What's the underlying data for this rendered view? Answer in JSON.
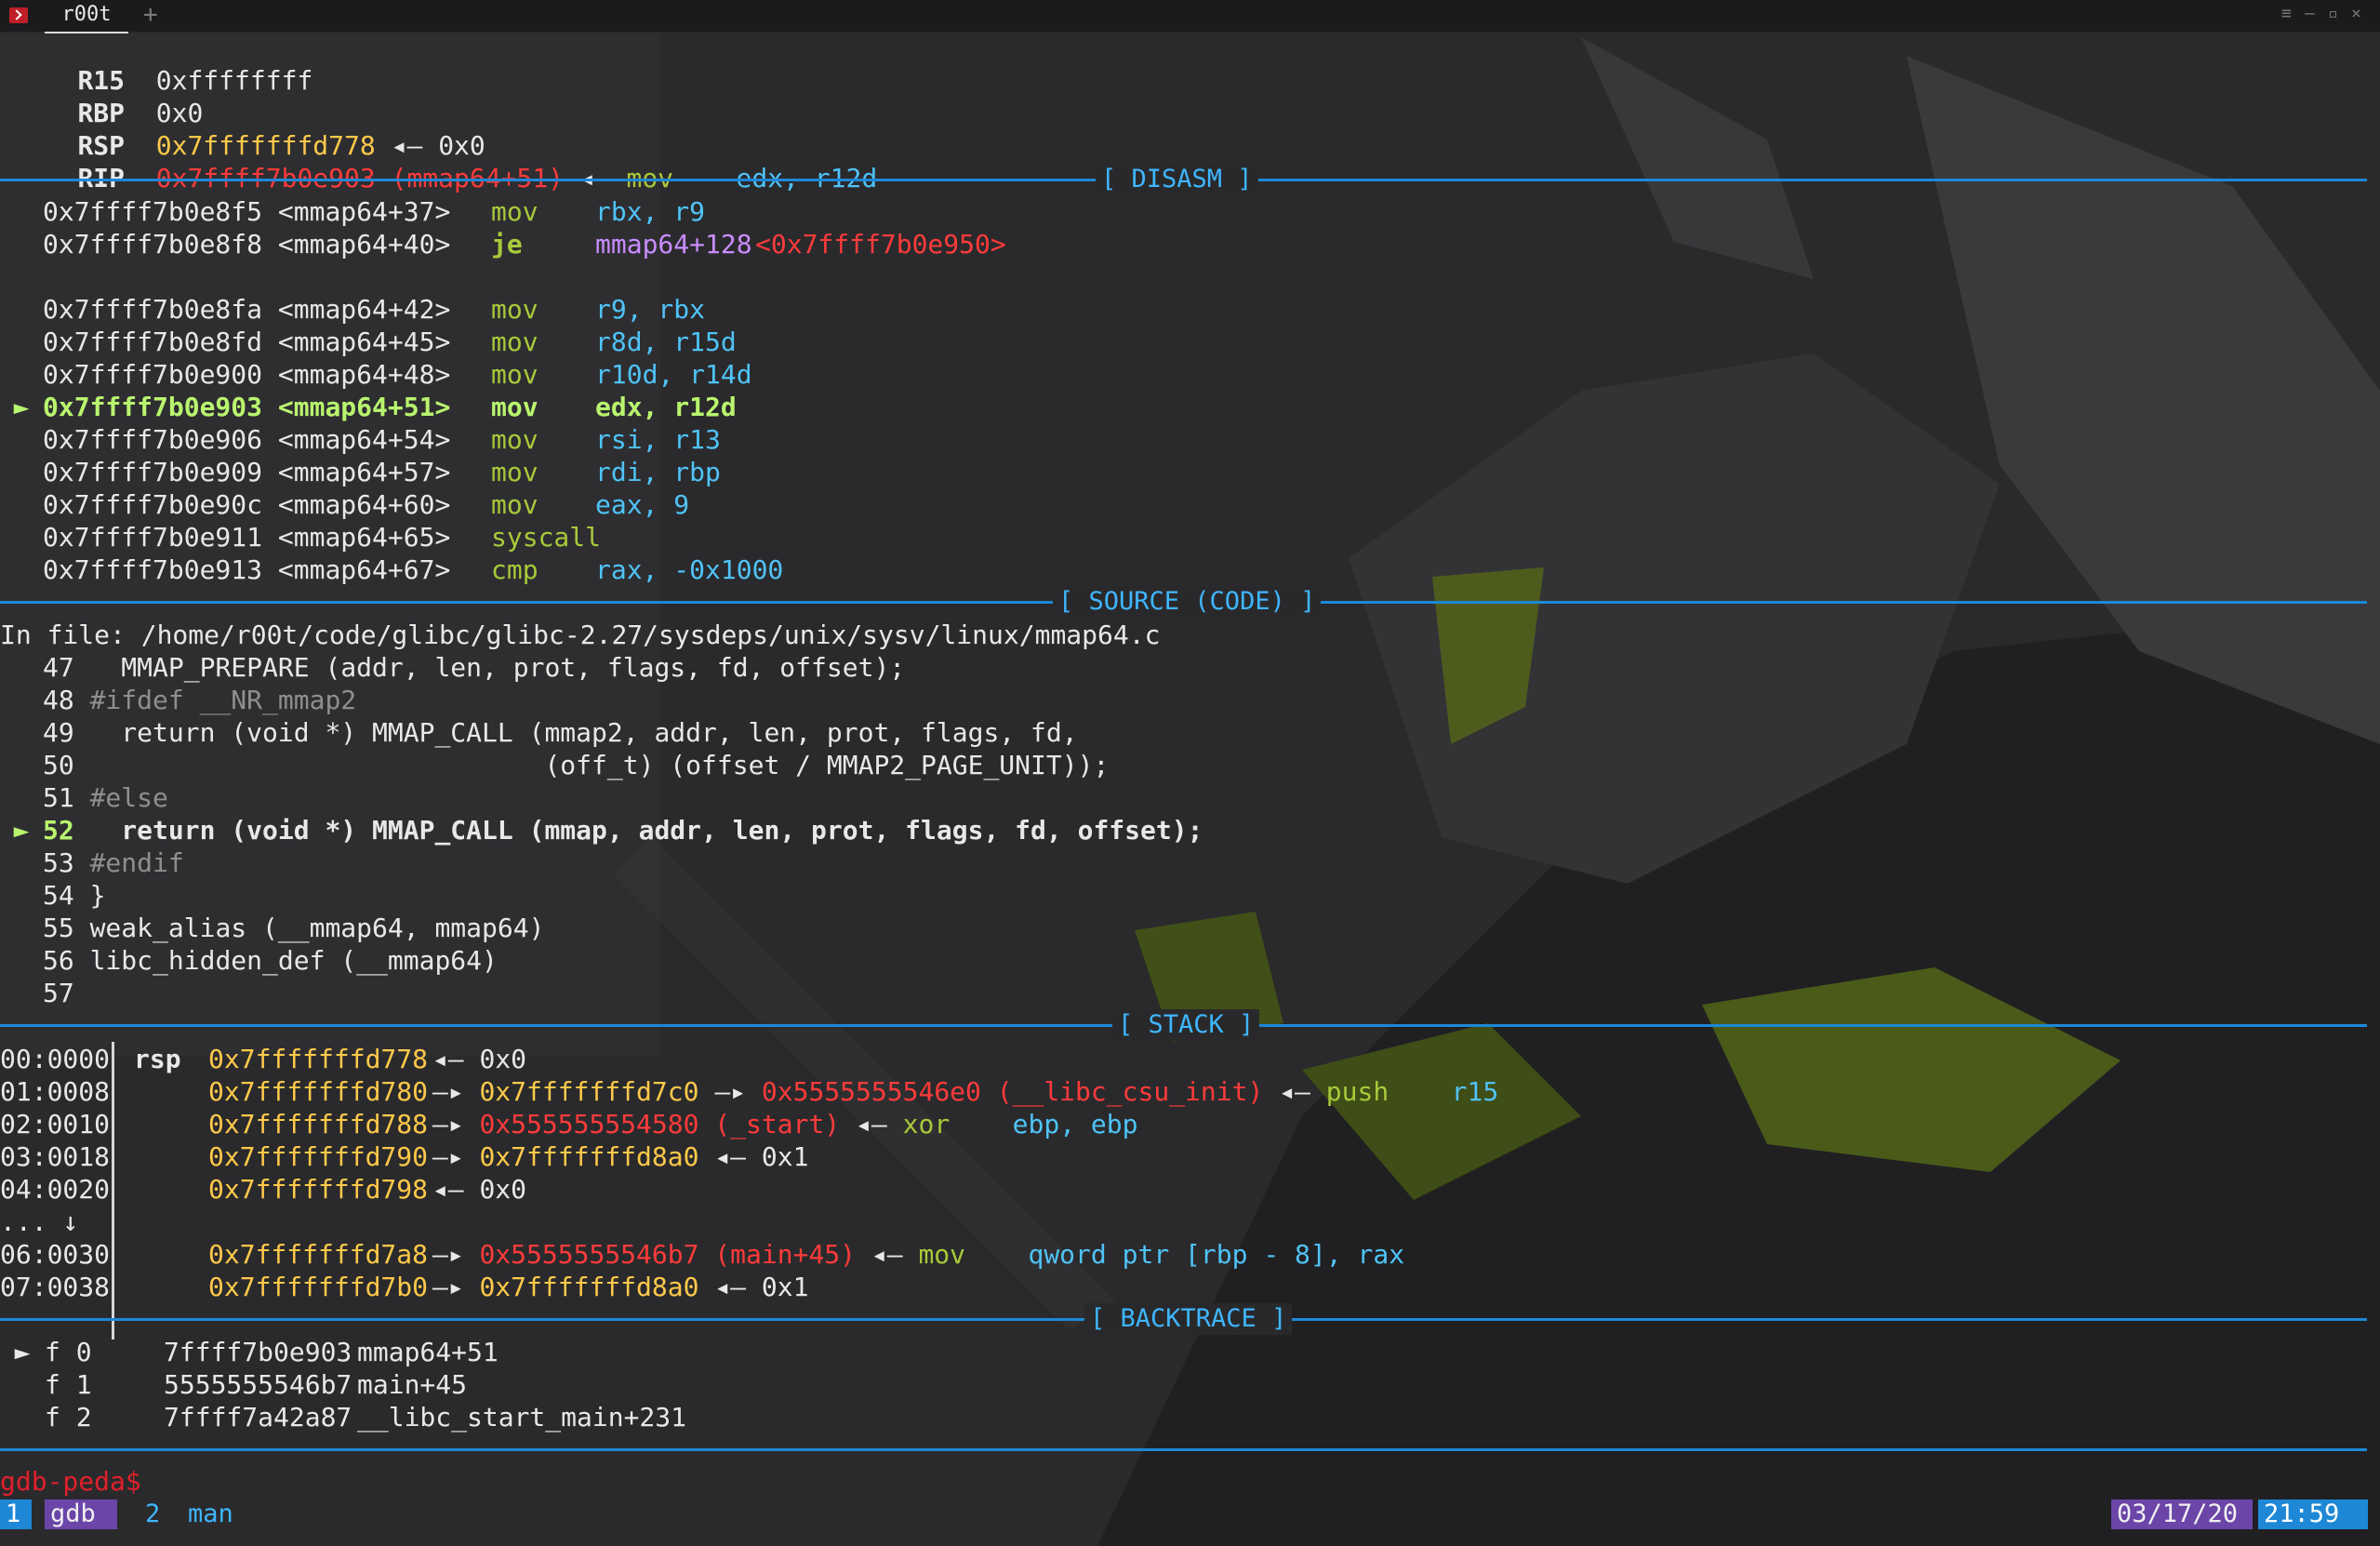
{
  "window": {
    "tab_title": "r00t",
    "new_tab": "+",
    "controls": [
      "≡",
      "–",
      "▫",
      "×"
    ]
  },
  "colors": {
    "background": "#262628",
    "separator": "#1e88d6",
    "section_label": "#3fb6ff",
    "address": "#ffc94a",
    "code_pointer": "#ff3b3b",
    "instruction": "#a8c93a",
    "operand": "#4fc3f7",
    "current": "#b9f56e",
    "prompt": "#e0202b",
    "status_window1": "#1e88d6",
    "status_date": "#6b45a8",
    "status_time": "#1e88d6"
  },
  "registers": [
    {
      "name": "R15",
      "value": "0xffffffff",
      "tail": ""
    },
    {
      "name": "RBP",
      "value": "0x0",
      "tail": ""
    },
    {
      "name": "RSP",
      "value": "0x7fffffffd778",
      "arrow": "◂—",
      "deref": "0x0"
    },
    {
      "name": "RIP",
      "value": "0x7ffff7b0e903 (mmap64+51)",
      "arrow": "◂—",
      "instr": "mov",
      "ops": "edx, r12d"
    }
  ],
  "sections": {
    "disasm": "[ DISASM ]",
    "source": "[ SOURCE (CODE) ]",
    "stack": "[ STACK ]",
    "backtrace": "[ BACKTRACE ]"
  },
  "disasm": [
    {
      "marker": "",
      "addr": "0x7ffff7b0e8f5",
      "sym": "<mmap64+37>",
      "instr": "mov",
      "ops": "rbx, r9"
    },
    {
      "marker": "",
      "addr": "0x7ffff7b0e8f8",
      "sym": "<mmap64+40>",
      "instr": "je",
      "ops": "mmap64+128",
      "target": "<0x7ffff7b0e950>"
    },
    {
      "marker": "",
      "addr": "",
      "sym": "",
      "instr": "",
      "ops": ""
    },
    {
      "marker": "",
      "addr": "0x7ffff7b0e8fa",
      "sym": "<mmap64+42>",
      "instr": "mov",
      "ops": "r9, rbx"
    },
    {
      "marker": "",
      "addr": "0x7ffff7b0e8fd",
      "sym": "<mmap64+45>",
      "instr": "mov",
      "ops": "r8d, r15d"
    },
    {
      "marker": "",
      "addr": "0x7ffff7b0e900",
      "sym": "<mmap64+48>",
      "instr": "mov",
      "ops": "r10d, r14d"
    },
    {
      "marker": "►",
      "addr": "0x7ffff7b0e903",
      "sym": "<mmap64+51>",
      "instr": "mov",
      "ops": "edx, r12d"
    },
    {
      "marker": "",
      "addr": "0x7ffff7b0e906",
      "sym": "<mmap64+54>",
      "instr": "mov",
      "ops": "rsi, r13"
    },
    {
      "marker": "",
      "addr": "0x7ffff7b0e909",
      "sym": "<mmap64+57>",
      "instr": "mov",
      "ops": "rdi, rbp"
    },
    {
      "marker": "",
      "addr": "0x7ffff7b0e90c",
      "sym": "<mmap64+60>",
      "instr": "mov",
      "ops": "eax, 9"
    },
    {
      "marker": "",
      "addr": "0x7ffff7b0e911",
      "sym": "<mmap64+65>",
      "instr": "syscall",
      "ops": ""
    },
    {
      "marker": "",
      "addr": "0x7ffff7b0e913",
      "sym": "<mmap64+67>",
      "instr": "cmp",
      "ops": "rax, -0x1000"
    }
  ],
  "source": {
    "file_line": "In file: /home/r00t/code/glibc/glibc-2.27/sysdeps/unix/sysv/linux/mmap64.c",
    "lines": [
      {
        "marker": "",
        "num": "47",
        "text": "  MMAP_PREPARE (addr, len, prot, flags, fd, offset);"
      },
      {
        "marker": "",
        "num": "48",
        "text": "#ifdef __NR_mmap2"
      },
      {
        "marker": "",
        "num": "49",
        "text": "  return (void *) MMAP_CALL (mmap2, addr, len, prot, flags, fd,"
      },
      {
        "marker": "",
        "num": "50",
        "text": "                             (off_t) (offset / MMAP2_PAGE_UNIT));"
      },
      {
        "marker": "",
        "num": "51",
        "text": "#else"
      },
      {
        "marker": "►",
        "num": "52",
        "text": "  return (void *) MMAP_CALL (mmap, addr, len, prot, flags, fd, offset);"
      },
      {
        "marker": "",
        "num": "53",
        "text": "#endif"
      },
      {
        "marker": "",
        "num": "54",
        "text": "}"
      },
      {
        "marker": "",
        "num": "55",
        "text": "weak_alias (__mmap64, mmap64)"
      },
      {
        "marker": "",
        "num": "56",
        "text": "libc_hidden_def (__mmap64)"
      },
      {
        "marker": "",
        "num": "57",
        "text": ""
      }
    ]
  },
  "stack": [
    {
      "idx": "00:0000",
      "reg": "rsp",
      "addr": "0x7fffffffd778",
      "chain": [
        {
          "a": "◂—"
        },
        {
          "v": "0x0",
          "c": "w"
        }
      ]
    },
    {
      "idx": "01:0008",
      "reg": "",
      "addr": "0x7fffffffd780",
      "chain": [
        {
          "a": "—▸"
        },
        {
          "v": "0x7fffffffd7c0",
          "c": "y"
        },
        {
          "a": "—▸"
        },
        {
          "v": "0x5555555546e0 (__libc_csu_init)",
          "c": "r"
        },
        {
          "a": "◂—"
        },
        {
          "v": "push",
          "c": "gr"
        },
        {
          "v": "r15",
          "c": "c"
        }
      ]
    },
    {
      "idx": "02:0010",
      "reg": "",
      "addr": "0x7fffffffd788",
      "chain": [
        {
          "a": "—▸"
        },
        {
          "v": "0x555555554580 (_start)",
          "c": "r"
        },
        {
          "a": "◂—"
        },
        {
          "v": "xor",
          "c": "gr"
        },
        {
          "v": "ebp, ebp",
          "c": "c"
        }
      ]
    },
    {
      "idx": "03:0018",
      "reg": "",
      "addr": "0x7fffffffd790",
      "chain": [
        {
          "a": "—▸"
        },
        {
          "v": "0x7fffffffd8a0",
          "c": "y"
        },
        {
          "a": "◂—"
        },
        {
          "v": "0x1",
          "c": "w"
        }
      ]
    },
    {
      "idx": "04:0020",
      "reg": "",
      "addr": "0x7fffffffd798",
      "chain": [
        {
          "a": "◂—"
        },
        {
          "v": "0x0",
          "c": "w"
        }
      ]
    },
    {
      "idx": "... ↓",
      "reg": "",
      "addr": "",
      "chain": []
    },
    {
      "idx": "06:0030",
      "reg": "",
      "addr": "0x7fffffffd7a8",
      "chain": [
        {
          "a": "—▸"
        },
        {
          "v": "0x5555555546b7 (main+45)",
          "c": "r"
        },
        {
          "a": "◂—"
        },
        {
          "v": "mov",
          "c": "gr"
        },
        {
          "v": "qword ptr [rbp - 8], rax",
          "c": "c"
        }
      ]
    },
    {
      "idx": "07:0038",
      "reg": "",
      "addr": "0x7fffffffd7b0",
      "chain": [
        {
          "a": "—▸"
        },
        {
          "v": "0x7fffffffd8a0",
          "c": "y"
        },
        {
          "a": "◂—"
        },
        {
          "v": "0x1",
          "c": "w"
        }
      ]
    }
  ],
  "backtrace": [
    {
      "marker": "►",
      "frame": "f 0",
      "addr": "7ffff7b0e903",
      "sym": "mmap64+51"
    },
    {
      "marker": "",
      "frame": "f 1",
      "addr": "5555555546b7",
      "sym": "main+45"
    },
    {
      "marker": "",
      "frame": "f 2",
      "addr": "7ffff7a42a87",
      "sym": "__libc_start_main+231"
    }
  ],
  "prompt": "gdb-peda$",
  "statusbar": {
    "win1_index": "1",
    "win1_name": "gdb",
    "win2_index": "2",
    "win2_name": "man",
    "date": "03/17/20",
    "time": "21:59"
  }
}
